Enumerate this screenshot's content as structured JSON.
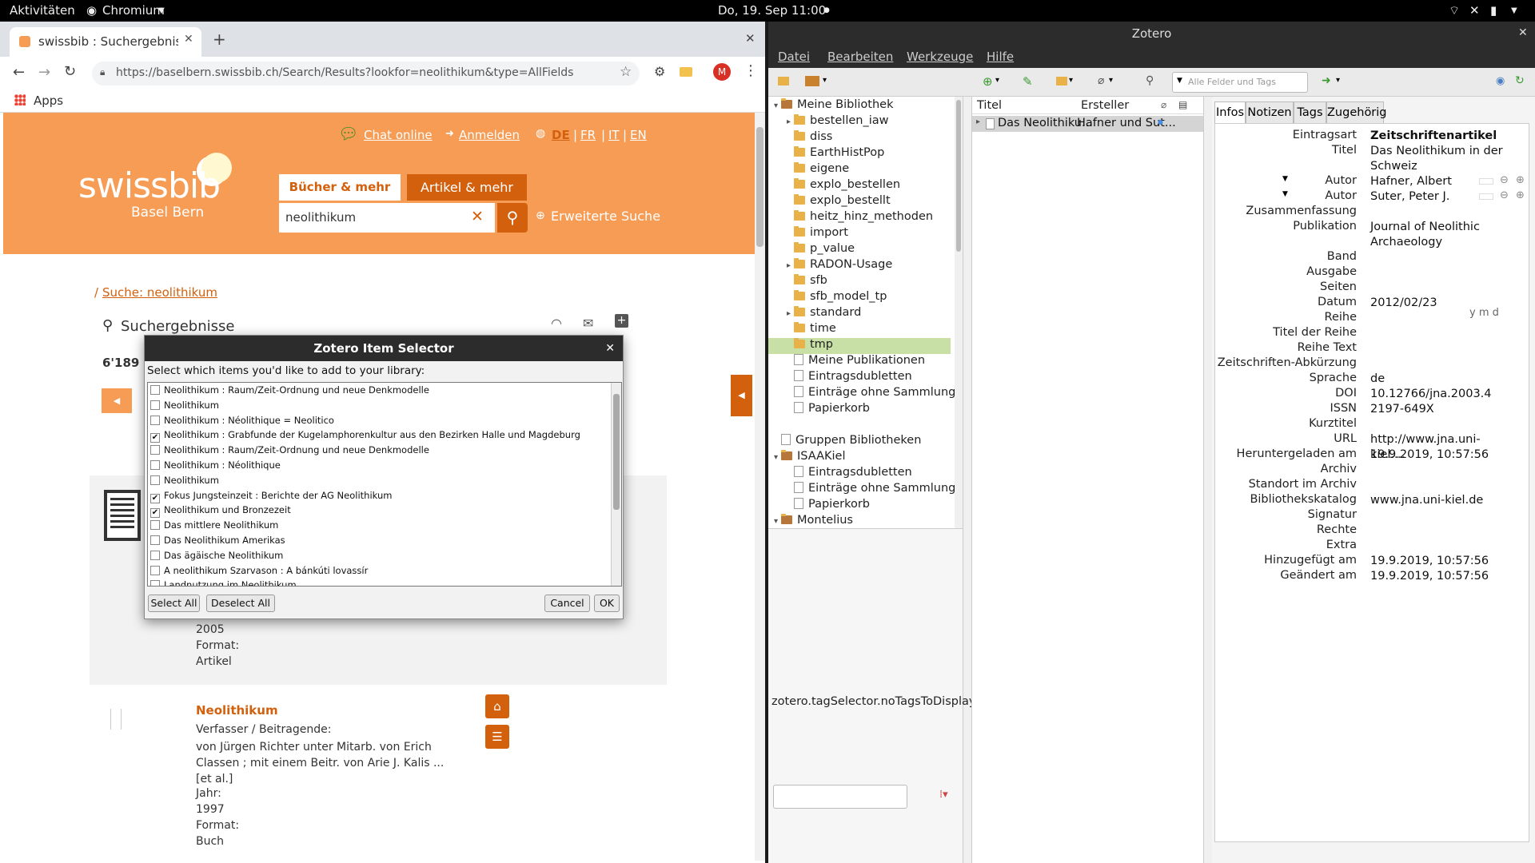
{
  "topbar": {
    "activities": "Aktivitäten",
    "app": "Chromium",
    "clock": "Do, 19. Sep  11:00"
  },
  "browser": {
    "tab_title": "swissbib : Suchergebnisse",
    "url": "https://baselbern.swissbib.ch/Search/Results?lookfor=neolithikum&type=AllFields",
    "bookmarks_apps": "Apps",
    "profile_initial": "M"
  },
  "swissbib": {
    "chat": "Chat online",
    "login": "Anmelden",
    "langs": [
      "DE",
      "FR",
      "IT",
      "EN"
    ],
    "logo": "swissbib",
    "logo_sub": "Basel Bern",
    "tab_books": "Bücher & mehr",
    "tab_articles": "Artikel & mehr",
    "search_value": "neolithikum",
    "advanced": "Erweiterte Suche",
    "breadcrumb": "Suche: neolithikum",
    "results_heading": "Suchergebnisse",
    "count": "6'189",
    "result1": {
      "year": "2005",
      "format_label": "Format:",
      "format": "Artikel"
    },
    "result2": {
      "title": "Neolithikum",
      "authors_label": "Verfasser / Beitragende:",
      "authors": "von Jürgen Richter unter Mitarb. von Erich Classen ; mit einem Beitr. von Arie J. Kalis ... [et al.]",
      "year_label": "Jahr:",
      "year": "1997",
      "format_label": "Format:",
      "format": "Buch"
    }
  },
  "dialog": {
    "title": "Zotero Item Selector",
    "prompt": "Select which items you'd like to add to your library:",
    "items": [
      {
        "label": "Neolithikum : Raum/Zeit-Ordnung und neue Denkmodelle",
        "checked": false
      },
      {
        "label": "Neolithikum",
        "checked": false
      },
      {
        "label": "Neolithikum : Néolithique = Neolitico",
        "checked": false
      },
      {
        "label": "Neolithikum : Grabfunde der Kugelamphorenkultur aus den Bezirken Halle und Magdeburg",
        "checked": true
      },
      {
        "label": "Neolithikum : Raum/Zeit-Ordnung und neue Denkmodelle",
        "checked": false
      },
      {
        "label": "Neolithikum : Néolithique",
        "checked": false
      },
      {
        "label": "Neolithikum",
        "checked": false
      },
      {
        "label": "Fokus Jungsteinzeit : Berichte der AG Neolithikum",
        "checked": true
      },
      {
        "label": "Neolithikum und Bronzezeit",
        "checked": true
      },
      {
        "label": "Das mittlere Neolithikum",
        "checked": false
      },
      {
        "label": "Das Neolithikum Amerikas",
        "checked": false
      },
      {
        "label": "Das ägäische Neolithikum",
        "checked": false
      },
      {
        "label": "A neolithikum Szarvason : A bánkúti lovassír",
        "checked": false
      },
      {
        "label": "Landnutzung im Neolithikum",
        "checked": false
      }
    ],
    "select_all": "Select All",
    "deselect_all": "Deselect All",
    "cancel": "Cancel",
    "ok": "OK"
  },
  "zotero": {
    "title": "Zotero",
    "menu": [
      "Datei",
      "Bearbeiten",
      "Werkzeuge",
      "Hilfe"
    ],
    "search_placeholder": "Alle Felder und Tags",
    "library": "Meine Bibliothek",
    "collections": [
      "bestellen_iaw",
      "diss",
      "EarthHistPop",
      "eigene",
      "explo_bestellen",
      "explo_bestellt",
      "heitz_hinz_methoden",
      "import",
      "p_value",
      "RADON-Usage",
      "sfb",
      "sfb_model_tp",
      "standard",
      "time",
      "tmp"
    ],
    "lib_extras": [
      "Meine Publikationen",
      "Eintragsdubletten",
      "Einträge ohne Sammlung",
      "Papierkorb"
    ],
    "groups": "Gruppen Bibliotheken",
    "group1": "ISAAKiel",
    "group1_items": [
      "Eintragsdubletten",
      "Einträge ohne Sammlung",
      "Papierkorb"
    ],
    "group2": "Montelius",
    "tags_empty": "zotero.tagSelector.noTagsToDisplay",
    "col_title": "Titel",
    "col_creator": "Ersteller",
    "item_title": "Das Neolithiku...",
    "item_creator": "Hafner und Sut...",
    "info_tabs": [
      "Infos",
      "Notizen",
      "Tags",
      "Zugehörig"
    ],
    "fields": [
      [
        "Eintragsart",
        "Zeitschriftenartikel"
      ],
      [
        "Titel",
        "Das Neolithikum in der Schweiz"
      ],
      [
        "Autor",
        "Hafner, Albert"
      ],
      [
        "Autor",
        "Suter, Peter J."
      ],
      [
        "Zusammenfassung",
        ""
      ],
      [
        "Publikation",
        "Journal of Neolithic Archaeology"
      ],
      [
        "Band",
        ""
      ],
      [
        "Ausgabe",
        ""
      ],
      [
        "Seiten",
        ""
      ],
      [
        "Datum",
        "2012/02/23"
      ],
      [
        "Reihe",
        ""
      ],
      [
        "Titel der Reihe",
        ""
      ],
      [
        "Reihe Text",
        ""
      ],
      [
        "Zeitschriften-Abkürzung",
        ""
      ],
      [
        "Sprache",
        "de"
      ],
      [
        "DOI",
        "10.12766/jna.2003.4"
      ],
      [
        "ISSN",
        "2197-649X"
      ],
      [
        "Kurztitel",
        ""
      ],
      [
        "URL",
        "http://www.jna.uni-kiel...."
      ],
      [
        "Heruntergeladen am",
        "19.9.2019, 10:57:56"
      ],
      [
        "Archiv",
        ""
      ],
      [
        "Standort im Archiv",
        ""
      ],
      [
        "Bibliothekskatalog",
        "www.jna.uni-kiel.de"
      ],
      [
        "Signatur",
        ""
      ],
      [
        "Rechte",
        ""
      ],
      [
        "Extra",
        ""
      ],
      [
        "Hinzugefügt am",
        "19.9.2019, 10:57:56"
      ],
      [
        "Geändert am",
        "19.9.2019, 10:57:56"
      ]
    ],
    "date_hint": "y m d"
  }
}
